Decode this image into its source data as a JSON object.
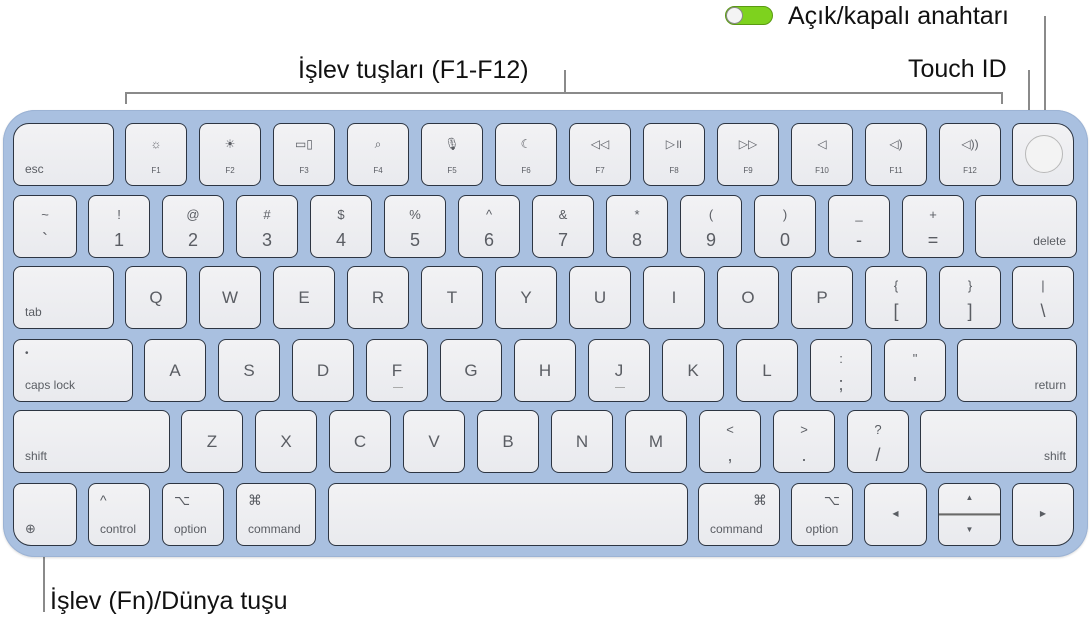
{
  "callouts": {
    "function_keys": "İşlev tuşları (F1-F12)",
    "power_switch": "Açık/kapalı anahtarı",
    "touch_id": "Touch ID",
    "fn_globe": "İşlev (Fn)/Dünya tuşu"
  },
  "colors": {
    "keyboard_body": "#a9c0e0",
    "key_face": "#eeeff2",
    "toggle_on": "#7ed21e"
  },
  "keyboard": {
    "row1": [
      {
        "label": "esc"
      },
      {
        "icon": "brightness-down-icon",
        "label": "F1"
      },
      {
        "icon": "brightness-up-icon",
        "label": "F2"
      },
      {
        "icon": "mission-control-icon",
        "label": "F3"
      },
      {
        "icon": "search-icon",
        "label": "F4"
      },
      {
        "icon": "microphone-icon",
        "label": "F5"
      },
      {
        "icon": "moon-icon",
        "label": "F6"
      },
      {
        "icon": "rewind-icon",
        "label": "F7"
      },
      {
        "icon": "play-pause-icon",
        "label": "F8"
      },
      {
        "icon": "fast-forward-icon",
        "label": "F9"
      },
      {
        "icon": "mute-icon",
        "label": "F10"
      },
      {
        "icon": "volume-down-icon",
        "label": "F11"
      },
      {
        "icon": "volume-up-icon",
        "label": "F12"
      },
      {
        "icon": "touch-id-icon"
      }
    ],
    "row2": [
      {
        "top": "~",
        "main": "`"
      },
      {
        "top": "!",
        "main": "1"
      },
      {
        "top": "@",
        "main": "2"
      },
      {
        "top": "#",
        "main": "3"
      },
      {
        "top": "$",
        "main": "4"
      },
      {
        "top": "%",
        "main": "5"
      },
      {
        "top": "^",
        "main": "6"
      },
      {
        "top": "&",
        "main": "7"
      },
      {
        "top": "*",
        "main": "8"
      },
      {
        "top": "(",
        "main": "9"
      },
      {
        "top": ")",
        "main": "0"
      },
      {
        "top": "_",
        "main": "-"
      },
      {
        "top": "+",
        "main": "="
      },
      {
        "label": "delete"
      }
    ],
    "row3": [
      {
        "label": "tab"
      },
      {
        "main": "Q"
      },
      {
        "main": "W"
      },
      {
        "main": "E"
      },
      {
        "main": "R"
      },
      {
        "main": "T"
      },
      {
        "main": "Y"
      },
      {
        "main": "U"
      },
      {
        "main": "I"
      },
      {
        "main": "O"
      },
      {
        "main": "P"
      },
      {
        "top": "{",
        "main": "["
      },
      {
        "top": "}",
        "main": "]"
      },
      {
        "top": "|",
        "main": "\\"
      }
    ],
    "row4": [
      {
        "label": "caps lock",
        "top": "•"
      },
      {
        "main": "A"
      },
      {
        "main": "S"
      },
      {
        "main": "D"
      },
      {
        "main": "F"
      },
      {
        "main": "G"
      },
      {
        "main": "H"
      },
      {
        "main": "J"
      },
      {
        "main": "K"
      },
      {
        "main": "L"
      },
      {
        "top": ":",
        "main": ";"
      },
      {
        "top": "\"",
        "main": "'"
      },
      {
        "label": "return"
      }
    ],
    "row5": [
      {
        "label": "shift"
      },
      {
        "main": "Z"
      },
      {
        "main": "X"
      },
      {
        "main": "C"
      },
      {
        "main": "V"
      },
      {
        "main": "B"
      },
      {
        "main": "N"
      },
      {
        "main": "M"
      },
      {
        "top": "<",
        "main": ","
      },
      {
        "top": ">",
        "main": "."
      },
      {
        "top": "?",
        "main": "/"
      },
      {
        "label": "shift"
      }
    ],
    "row6": [
      {
        "icon": "globe-icon"
      },
      {
        "top": "^",
        "label": "control"
      },
      {
        "top": "⌥",
        "label": "option"
      },
      {
        "top": "⌘",
        "label": "command"
      },
      {
        "label": ""
      },
      {
        "top": "⌘",
        "label": "command"
      },
      {
        "top": "⌥",
        "label": "option"
      },
      {
        "icon": "arrow-left-icon"
      },
      {
        "icon": "arrow-up-down-icon"
      },
      {
        "icon": "arrow-right-icon"
      }
    ]
  }
}
